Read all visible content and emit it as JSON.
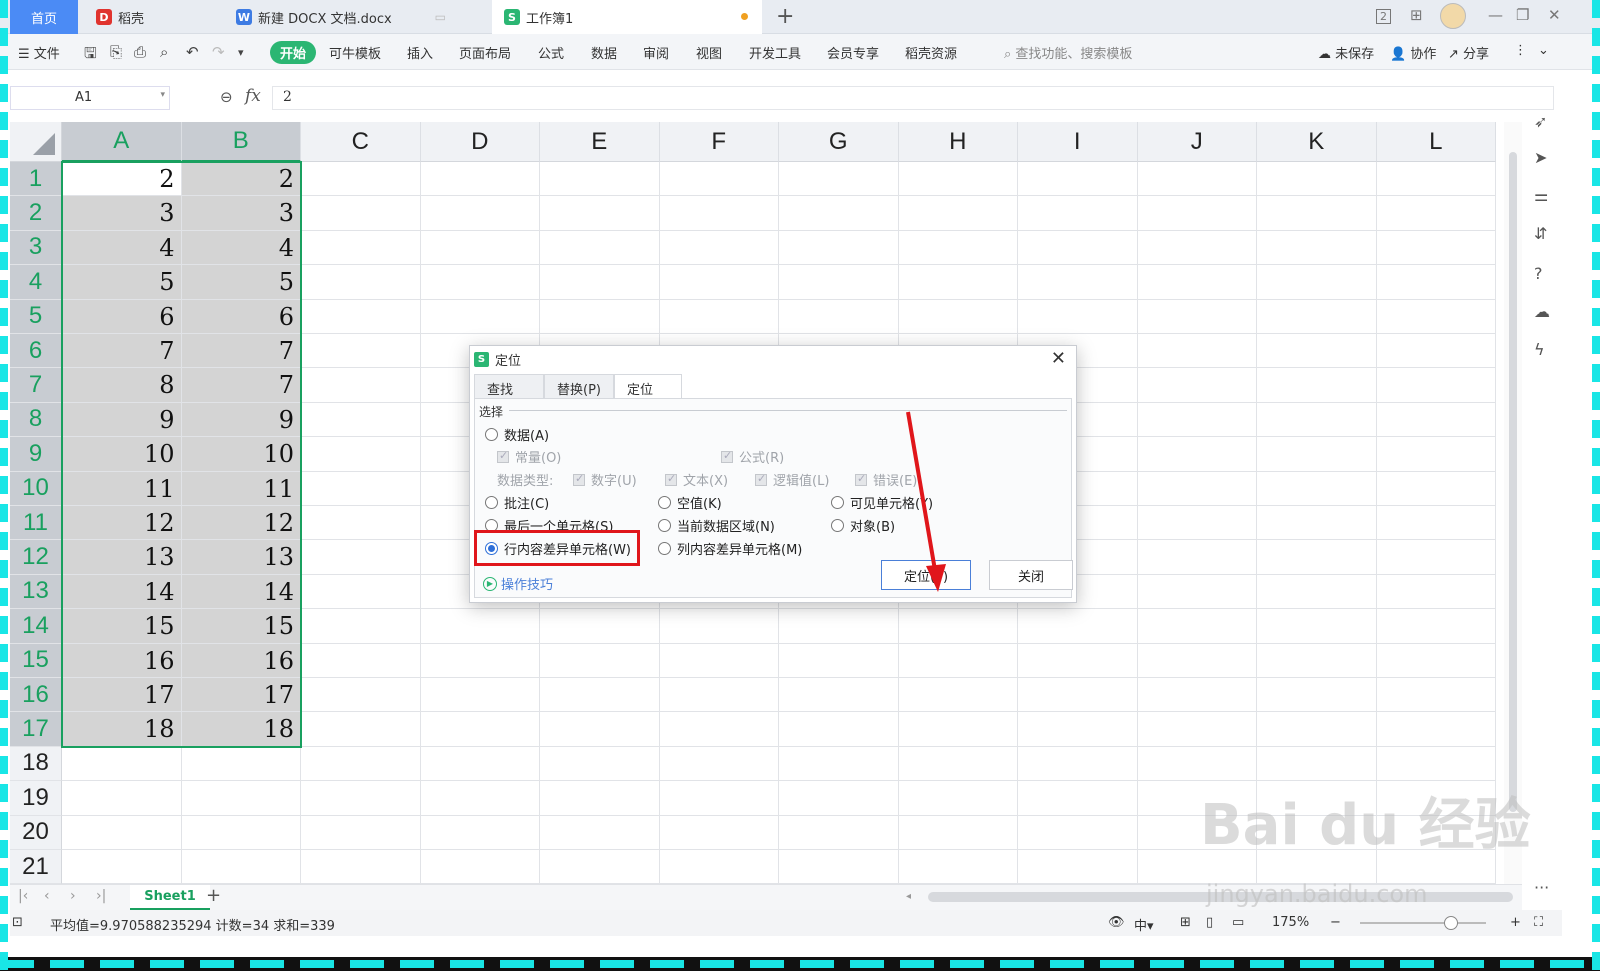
{
  "titlebar": {
    "tabs": [
      {
        "label": "首页",
        "icon": "home"
      },
      {
        "label": "稻壳",
        "icon": "docer-icon"
      },
      {
        "label": "新建 DOCX 文档.docx",
        "icon": "word-icon"
      },
      {
        "label": "工作簿1",
        "icon": "sheet-icon"
      }
    ],
    "page_num": "2"
  },
  "ribbon": {
    "file": "文件",
    "start": "开始",
    "items": [
      "可牛模板",
      "插入",
      "页面布局",
      "公式",
      "数据",
      "审阅",
      "视图",
      "开发工具",
      "会员专享",
      "稻壳资源"
    ],
    "search": "查找功能、搜索模板",
    "unsaved": "未保存",
    "collab": "协作",
    "share": "分享"
  },
  "formula_bar": {
    "name_box": "A1",
    "fx": "fx",
    "value": "2"
  },
  "grid": {
    "columns": [
      "A",
      "B",
      "C",
      "D",
      "E",
      "F",
      "G",
      "H",
      "I",
      "J",
      "K",
      "L"
    ],
    "rows": [
      "1",
      "2",
      "3",
      "4",
      "5",
      "6",
      "7",
      "8",
      "9",
      "10",
      "11",
      "12",
      "13",
      "14",
      "15",
      "16",
      "17",
      "18",
      "19",
      "20",
      "21"
    ],
    "colA": [
      "2",
      "3",
      "4",
      "5",
      "6",
      "7",
      "8",
      "9",
      "10",
      "11",
      "12",
      "13",
      "14",
      "15",
      "16",
      "17",
      "18"
    ],
    "colB": [
      "2",
      "3",
      "4",
      "5",
      "6",
      "7",
      "7",
      "9",
      "10",
      "11",
      "12",
      "13",
      "14",
      "15",
      "16",
      "17",
      "18"
    ]
  },
  "sheetbar": {
    "sheet": "Sheet1",
    "add": "+"
  },
  "status": {
    "stats": "平均值=9.970588235294  计数=34  求和=339",
    "zoom": "175%"
  },
  "dialog": {
    "title": "定位",
    "tabs": [
      "查找(D)",
      "替换(P)",
      "定位(G)"
    ],
    "group": "选择",
    "data_opt": "数据(A)",
    "const": "常量(O)",
    "formula": "公式(R)",
    "data_type": "数据类型:",
    "number": "数字(U)",
    "text": "文本(X)",
    "logical": "逻辑值(L)",
    "error": "错误(E)",
    "comment": "批注(C)",
    "blank": "空值(K)",
    "visible": "可见单元格(Y)",
    "last_cell": "最后一个单元格(S)",
    "current_region": "当前数据区域(N)",
    "object": "对象(B)",
    "row_diff": "行内容差异单元格(W)",
    "col_diff": "列内容差异单元格(M)",
    "tips": "操作技巧",
    "ok": "定位(T)",
    "close": "关闭"
  },
  "colors": {
    "accent": "#19a05f",
    "highlight": "#e0161b"
  },
  "watermark": {
    "main": "Bai du 经验",
    "url": "jingyan.baidu.com"
  }
}
